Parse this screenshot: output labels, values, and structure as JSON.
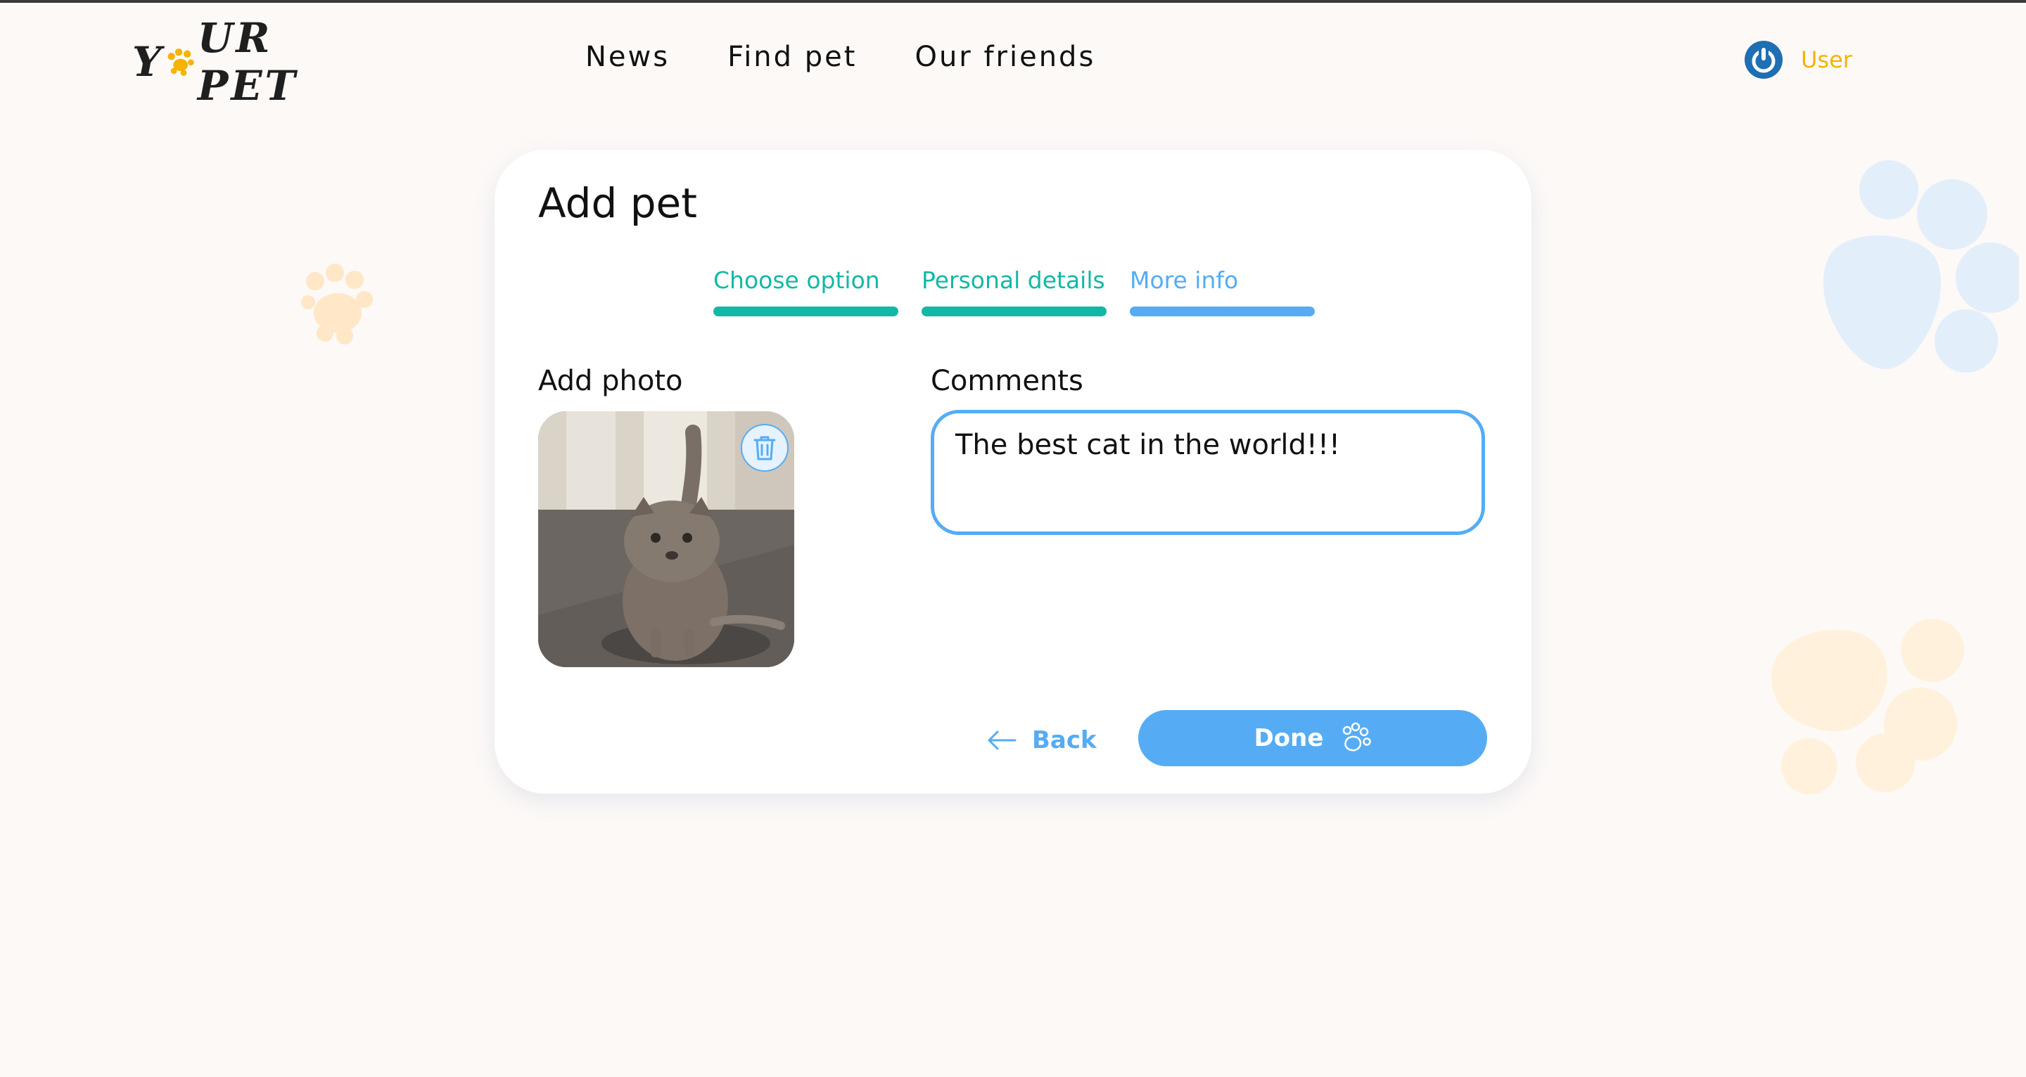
{
  "header": {
    "logo_alt": "Your Pet",
    "logo_text_left": "Y",
    "logo_text_right": "UR PET",
    "nav": [
      {
        "label": "News"
      },
      {
        "label": "Find pet"
      },
      {
        "label": "Our friends"
      }
    ],
    "user_label": "User"
  },
  "form": {
    "title": "Add pet",
    "steps": [
      {
        "label": "Choose option",
        "state": "done"
      },
      {
        "label": "Personal details",
        "state": "done"
      },
      {
        "label": "More info",
        "state": "active"
      }
    ],
    "photo_label": "Add photo",
    "comments_label": "Comments",
    "comments_value": "The best cat in the world!!!",
    "back_label": "Back",
    "done_label": "Done"
  },
  "colors": {
    "accent_blue": "#55acf4",
    "success_teal": "#12b8a6",
    "user_yellow": "#f4b400",
    "background": "#fcf9f7"
  },
  "icons": {
    "user": "power-icon",
    "delete_photo": "trash-icon",
    "back": "arrow-left-icon",
    "done": "paw-icon"
  }
}
